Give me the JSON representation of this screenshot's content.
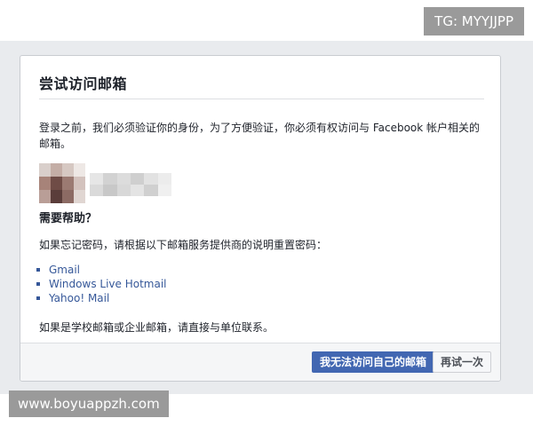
{
  "watermarks": {
    "top": "TG: MYYJJPP",
    "bottom": "www.boyuappzh.com"
  },
  "dialog": {
    "title": "尝试访问邮箱",
    "intro": "登录之前，我们必须验证你的身份，为了方便验证，你必须有权访问与 Facebook 帐户相关的邮箱。",
    "help_heading": "需要帮助？",
    "help_text": "如果忘记密码，请根据以下邮箱服务提供商的说明重置密码：",
    "providers": [
      "Gmail",
      "Windows Live Hotmail",
      "Yahoo! Mail"
    ],
    "contact_text": "如果是学校邮箱或企业邮箱，请直接与单位联系。",
    "buttons": {
      "primary": "我无法访问自己的邮箱",
      "secondary": "再试一次"
    }
  },
  "colors": {
    "link": "#365899",
    "primary_button": "#4267b2",
    "backdrop": "#e9ebee"
  }
}
